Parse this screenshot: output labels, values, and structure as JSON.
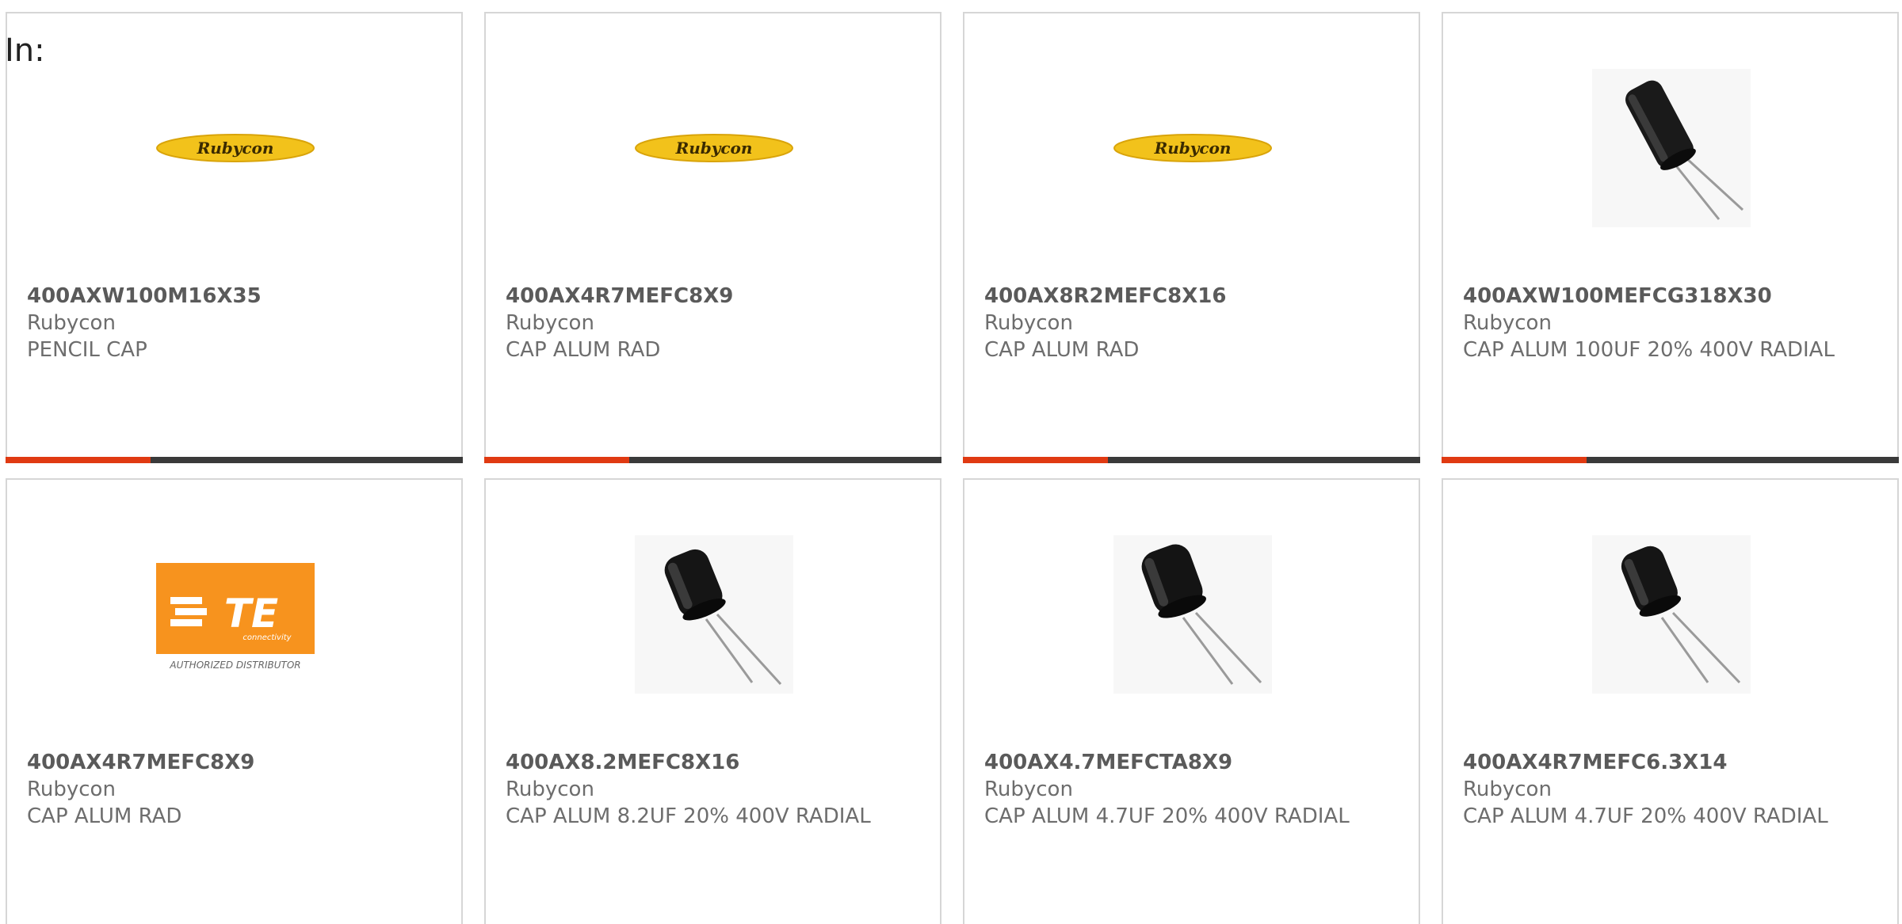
{
  "filter": {
    "in_label": "In:"
  },
  "colors": {
    "accent": "#e03a12",
    "bar": "#3a3a3a",
    "rubycon_yellow": "#f2c21b",
    "te_orange": "#f7931e"
  },
  "cards": [
    {
      "image": "rubycon-logo",
      "logo_text": "Rubycon",
      "part_number": "400AXW100M16X35",
      "manufacturer": "Rubycon",
      "description": "PENCIL CAP",
      "progress_bar": true
    },
    {
      "image": "rubycon-logo",
      "logo_text": "Rubycon",
      "part_number": "400AX4R7MEFC8X9",
      "manufacturer": "Rubycon",
      "description": "CAP ALUM RAD",
      "progress_bar": true
    },
    {
      "image": "rubycon-logo",
      "logo_text": "Rubycon",
      "part_number": "400AX8R2MEFC8X16",
      "manufacturer": "Rubycon",
      "description": "CAP ALUM RAD",
      "progress_bar": true
    },
    {
      "image": "capacitor-photo",
      "part_number": "400AXW100MEFCG318X30",
      "manufacturer": "Rubycon",
      "description": "CAP ALUM 100UF 20% 400V RADIAL",
      "progress_bar": true
    },
    {
      "image": "te-logo",
      "logo_text": "TE",
      "logo_sub": "connectivity",
      "logo_caption": "AUTHORIZED DISTRIBUTOR",
      "part_number": "400AX4R7MEFC8X9",
      "manufacturer": "Rubycon",
      "description": "CAP ALUM RAD"
    },
    {
      "image": "capacitor-photo",
      "part_number": "400AX8.2MEFC8X16",
      "manufacturer": "Rubycon",
      "description": "CAP ALUM 8.2UF 20% 400V RADIAL"
    },
    {
      "image": "capacitor-photo",
      "part_number": "400AX4.7MEFCTA8X9",
      "manufacturer": "Rubycon",
      "description": "CAP ALUM 4.7UF 20% 400V RADIAL"
    },
    {
      "image": "capacitor-photo",
      "part_number": "400AX4R7MEFC6.3X14",
      "manufacturer": "Rubycon",
      "description": "CAP ALUM 4.7UF 20% 400V RADIAL"
    }
  ]
}
